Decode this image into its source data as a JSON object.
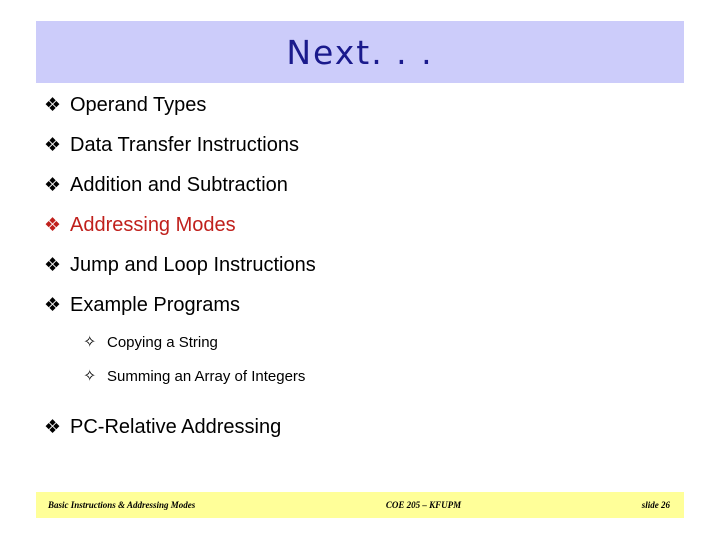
{
  "slide": {
    "title": "Next. . .",
    "title_bar_color": "#ccccfa",
    "title_text_color": "#1a1a8c",
    "background_color": "#ffffff"
  },
  "bullets": [
    {
      "level": 1,
      "glyph": "❖",
      "glyph_name": "diamond-bullet-icon",
      "label": "Operand Types",
      "color": "#000000"
    },
    {
      "level": 1,
      "glyph": "❖",
      "glyph_name": "diamond-bullet-icon",
      "label": "Data Transfer Instructions",
      "color": "#000000"
    },
    {
      "level": 1,
      "glyph": "❖",
      "glyph_name": "diamond-bullet-icon",
      "label": "Addition and Subtraction",
      "color": "#000000"
    },
    {
      "level": 1,
      "glyph": "❖",
      "glyph_name": "diamond-bullet-icon",
      "label": "Addressing Modes",
      "color": "#c0201c"
    },
    {
      "level": 1,
      "glyph": "❖",
      "glyph_name": "diamond-bullet-icon",
      "label": "Jump and Loop Instructions",
      "color": "#000000"
    },
    {
      "level": 1,
      "glyph": "❖",
      "glyph_name": "diamond-bullet-icon",
      "label": "Example Programs",
      "color": "#000000"
    },
    {
      "level": 2,
      "glyph": "✧",
      "glyph_name": "star-bullet-icon",
      "label": "Copying a String",
      "color": "#000000"
    },
    {
      "level": 2,
      "glyph": "✧",
      "glyph_name": "star-bullet-icon",
      "label": "Summing an Array of Integers",
      "color": "#000000"
    },
    {
      "level": 1,
      "glyph": "❖",
      "glyph_name": "diamond-bullet-icon",
      "label": "PC-Relative Addressing",
      "color": "#000000"
    }
  ],
  "footer": {
    "left": "Basic Instructions & Addressing Modes",
    "center": "COE 205 – KFUPM",
    "right": "slide 26",
    "bar_color": "#ffff99"
  }
}
